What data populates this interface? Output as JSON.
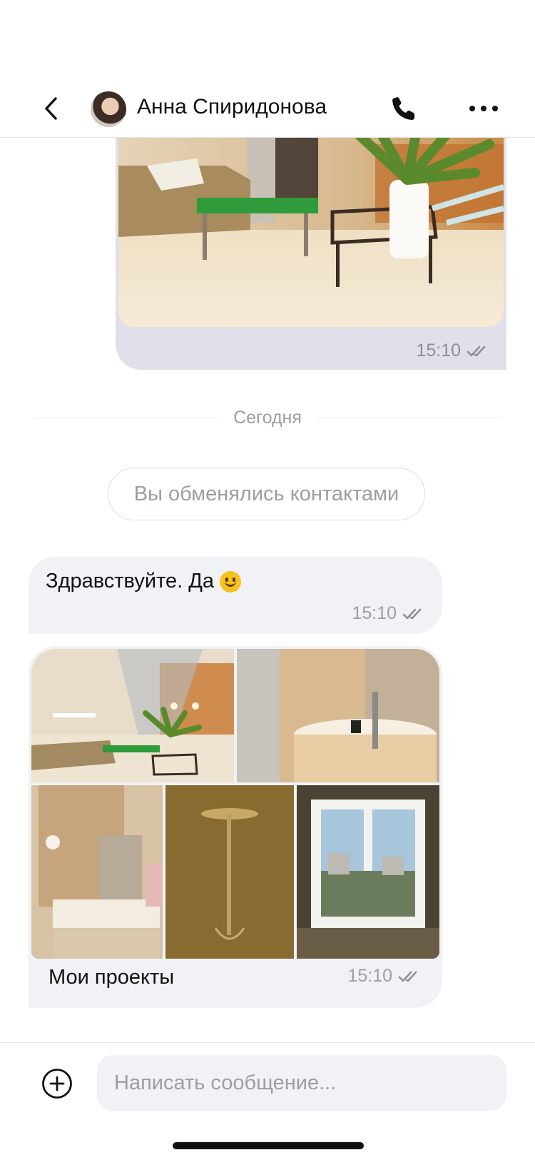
{
  "header": {
    "contact_name": "Анна Спиридонова",
    "icons": {
      "back": "chevron-left-icon",
      "call": "phone-icon",
      "more": "more-horizontal-icon"
    }
  },
  "messages": {
    "outgoing_photo": {
      "time": "15:10",
      "status": "read"
    },
    "day_separator": "Сегодня",
    "system_notice": "Вы обменялись контактами",
    "incoming_text": {
      "text": "Здравствуйте. Да",
      "emoji": "smile-emoji-icon",
      "time": "15:10",
      "status": "read"
    },
    "album": {
      "caption": "Мои проекты",
      "time": "15:10",
      "status": "read",
      "photos": [
        "living-room-photo",
        "bathroom-tub-photo",
        "bathroom-sink-photo",
        "shower-photo",
        "window-view-photo"
      ]
    }
  },
  "composer": {
    "placeholder": "Написать сообщение...",
    "attach_icon": "add-circle-icon"
  },
  "colors": {
    "outgoing_bubble": "#dfe0ea",
    "incoming_bubble": "#f1f2f5",
    "meta_text": "#9a9ea6"
  }
}
